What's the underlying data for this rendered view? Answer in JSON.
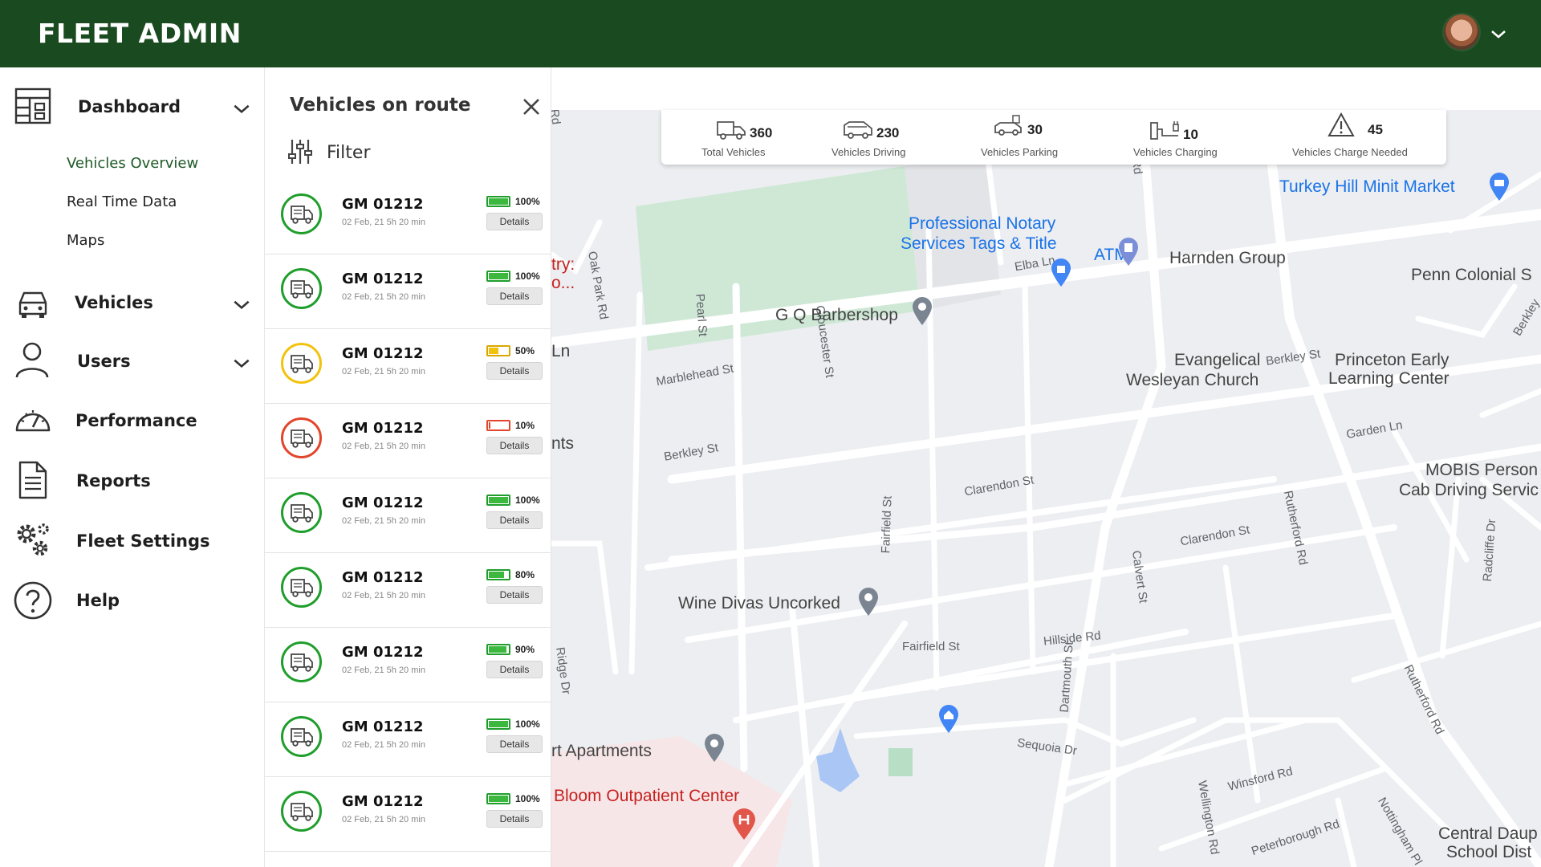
{
  "header": {
    "brand": "FLEET ADMIN",
    "avatar": "user-avatar",
    "caret": "chevron-down-icon"
  },
  "sidebar": {
    "items": [
      {
        "label": "Dashboard",
        "icon": "dashboard-icon",
        "expandable": true,
        "subitems": [
          {
            "label": "Vehicles Overview",
            "active": true
          },
          {
            "label": "Real Time Data",
            "active": false
          },
          {
            "label": "Maps",
            "active": false
          }
        ]
      },
      {
        "label": "Vehicles",
        "icon": "car-icon",
        "expandable": true
      },
      {
        "label": "Users",
        "icon": "user-icon",
        "expandable": true
      },
      {
        "label": "Performance",
        "icon": "speedometer-icon",
        "expandable": false
      },
      {
        "label": "Reports",
        "icon": "document-icon",
        "expandable": false
      },
      {
        "label": "Fleet Settings",
        "icon": "gears-icon",
        "expandable": false
      },
      {
        "label": "Help",
        "icon": "help-icon",
        "expandable": false
      }
    ]
  },
  "panel": {
    "title": "Vehicles on route",
    "filter_label": "Filter",
    "vehicles": [
      {
        "name": "GM 01212",
        "time": "02 Feb, 21 5h 20 min",
        "battery": "100%",
        "battery_level": 1.0,
        "status_color": "#1f9e2c",
        "details": "Details"
      },
      {
        "name": "GM 01212",
        "time": "02 Feb, 21 5h 20 min",
        "battery": "100%",
        "battery_level": 1.0,
        "status_color": "#1f9e2c",
        "details": "Details"
      },
      {
        "name": "GM 01212",
        "time": "02 Feb, 21 5h 20 min",
        "battery": "50%",
        "battery_level": 0.5,
        "status_color": "#f2c20c",
        "details": "Details"
      },
      {
        "name": "GM 01212",
        "time": "02 Feb, 21 5h 20 min",
        "battery": "10%",
        "battery_level": 0.1,
        "status_color": "#e2452b",
        "details": "Details"
      },
      {
        "name": "GM 01212",
        "time": "02 Feb, 21 5h 20 min",
        "battery": "100%",
        "battery_level": 1.0,
        "status_color": "#1f9e2c",
        "details": "Details"
      },
      {
        "name": "GM 01212",
        "time": "02 Feb, 21 5h 20 min",
        "battery": "80%",
        "battery_level": 0.8,
        "status_color": "#1f9e2c",
        "details": "Details"
      },
      {
        "name": "GM 01212",
        "time": "02 Feb, 21 5h 20 min",
        "battery": "90%",
        "battery_level": 0.9,
        "status_color": "#1f9e2c",
        "details": "Details"
      },
      {
        "name": "GM 01212",
        "time": "02 Feb, 21 5h 20 min",
        "battery": "100%",
        "battery_level": 1.0,
        "status_color": "#1f9e2c",
        "details": "Details"
      },
      {
        "name": "GM 01212",
        "time": "02 Feb, 21 5h 20 min",
        "battery": "100%",
        "battery_level": 1.0,
        "status_color": "#1f9e2c",
        "details": "Details"
      }
    ]
  },
  "stats": [
    {
      "value": "360",
      "label": "Total Vehicles",
      "icon": "truck-icon"
    },
    {
      "value": "230",
      "label": "Vehicles Driving",
      "icon": "van-icon"
    },
    {
      "value": "30",
      "label": "Vehicles Parking",
      "icon": "parking-icon"
    },
    {
      "value": "10",
      "label": "Vehicles Charging",
      "icon": "charging-icon"
    },
    {
      "value": "45",
      "label": "Vehicles Charge Needed",
      "icon": "warning-icon"
    }
  ],
  "map": {
    "streets": [
      "Marblehead St",
      "Berkley St",
      "Berkley St",
      "Elba Ln",
      "Pearl St",
      "Gloucester St",
      "Fairfield St",
      "Fairfield St",
      "Clarendon St",
      "Clarendon St",
      "Hillside Rd",
      "Calvert St",
      "Dartmouth St",
      "Sequoia Dr",
      "Winsford Rd",
      "Wellington Rd",
      "Peterborough Rd",
      "Nottingham Pl",
      "Rutherford Rd",
      "Rutherford Rd",
      "Radcliffe Dr",
      "Garden Ln",
      "Oak Park Rd",
      "Ridge Dr",
      "Rd",
      "Rd",
      "Berkley"
    ],
    "places": [
      "Professional Notary",
      "Services Tags & Title",
      "ATM",
      "Harnden Group",
      "Turkey Hill Minit Market",
      "Penn Colonial S",
      "G Q Barbershop",
      "Evangelical",
      "Wesleyan Church",
      "Princeton Early",
      "Learning Center",
      "MOBIS Person",
      "Cab Driving Servic",
      "Wine Divas Uncorked",
      "rt Apartments",
      "Bloom Outpatient Center",
      "Central Daup",
      "School Dist",
      "try:",
      "o...",
      "Ln",
      "nts"
    ]
  }
}
